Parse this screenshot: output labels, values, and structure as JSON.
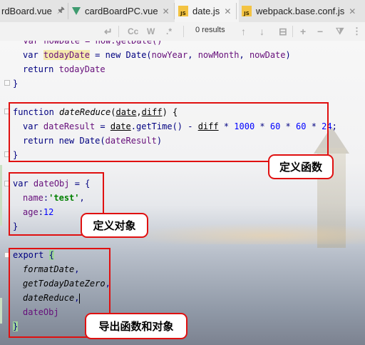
{
  "tabs": [
    {
      "label": "rdBoard.vue",
      "pinned": true,
      "icon": "vue-icon"
    },
    {
      "label": "cardBoardPC.vue",
      "icon": "vue-icon"
    },
    {
      "label": "date.js",
      "icon": "js-icon",
      "active": true
    },
    {
      "label": "webpack.base.conf.js",
      "icon": "js-icon"
    }
  ],
  "tab_icon_text": "JS",
  "toolbar": {
    "match_case_label": "Cc",
    "words_label": "W",
    "regex_label": ".*",
    "results": "0 results"
  },
  "code": {
    "line_top": "  var nowDate = now.getDate()",
    "var_today_kw": "var",
    "today_id": "todayDate",
    "today_rest_1": " = new Date(",
    "today_now_year": "nowYear",
    "today_comma_1": ", ",
    "today_now_month": "nowMonth",
    "today_comma_2": ", ",
    "today_now_date": "nowDate",
    "today_rest_2": ")",
    "return_kw": "return",
    "return_today": "todayDate",
    "close_brace": "}",
    "fn_kw": "function",
    "fn_name": "dateReduce",
    "fn_open": "(",
    "param_date": "date",
    "param_comma": ",",
    "param_diff": "diff",
    "fn_close": ") {",
    "var_kw": "var",
    "date_result": "dateResult",
    "eq": " = ",
    "date_ref": "date",
    "get_time": ".getTime() - ",
    "diff_ref": "diff",
    "mult": " * ",
    "n1000": "1000",
    "n60a": "60",
    "n60b": "60",
    "n24": "24",
    "semi": ";",
    "return_new": " new Date(",
    "return_arg": "dateResult",
    "return_close": ")",
    "obj_var": "var",
    "obj_name": "dateObj",
    "obj_open": " = {",
    "name_key": "name",
    "name_colon": ":",
    "name_val": "'test'",
    "name_comma": ",",
    "age_key": "age",
    "age_colon": ":",
    "age_val": "12",
    "export_kw": "export",
    "export_open": "{",
    "exp1": "formatDate",
    "exp2": "getTodayDateZero",
    "exp3": "dateReduce",
    "exp4": "dateObj",
    "comma": ","
  },
  "annotations": {
    "define_function": "定义函数",
    "define_object": "定义对象",
    "export_all": "导出函数和对象"
  },
  "colors": {
    "annotation_border": "#e01010",
    "keyword": "#000080",
    "identifier": "#660e7a",
    "number": "#0000ff",
    "string": "#008000"
  }
}
